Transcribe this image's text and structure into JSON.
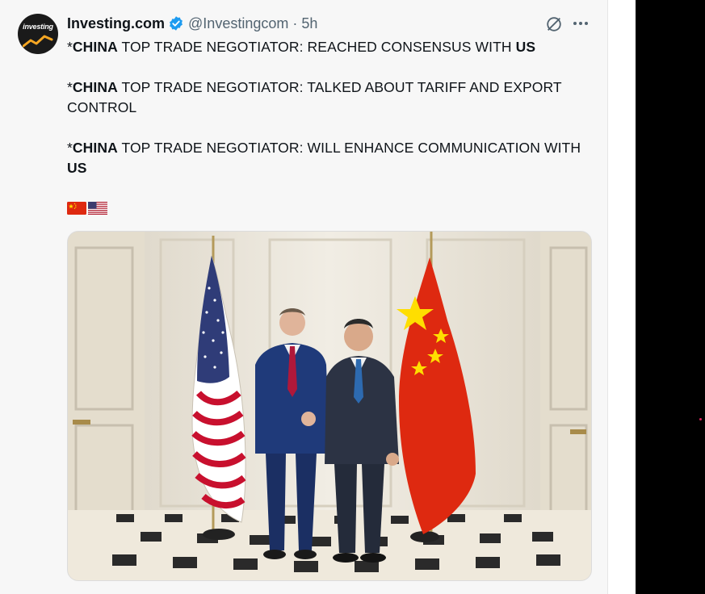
{
  "tweet": {
    "display_name": "Investing.com",
    "handle": "@Investingcom",
    "separator": "·",
    "time": "5h",
    "avatar_text": "investing",
    "lines": [
      {
        "prefix": "*",
        "bold": "CHINA",
        "rest": " TOP TRADE NEGOTIATOR: REACHED CONSENSUS WITH ",
        "tail_bold": "US",
        "tail": ""
      },
      {
        "prefix": "*",
        "bold": "CHINA",
        "rest": " TOP TRADE NEGOTIATOR: TALKED ABOUT TARIFF AND EXPORT CONTROL",
        "tail_bold": "",
        "tail": ""
      },
      {
        "prefix": "*",
        "bold": "CHINA",
        "rest": " TOP TRADE NEGOTIATOR: WILL ENHANCE COMMUNICATION WITH ",
        "tail_bold": "US",
        "tail": ""
      }
    ],
    "flags": [
      "china-flag-icon",
      "us-flag-icon"
    ]
  },
  "colors": {
    "text": "#0f1419",
    "secondary": "#536471",
    "verified": "#1d9bf0",
    "china_red": "#de2910",
    "china_yellow": "#ffde00"
  }
}
